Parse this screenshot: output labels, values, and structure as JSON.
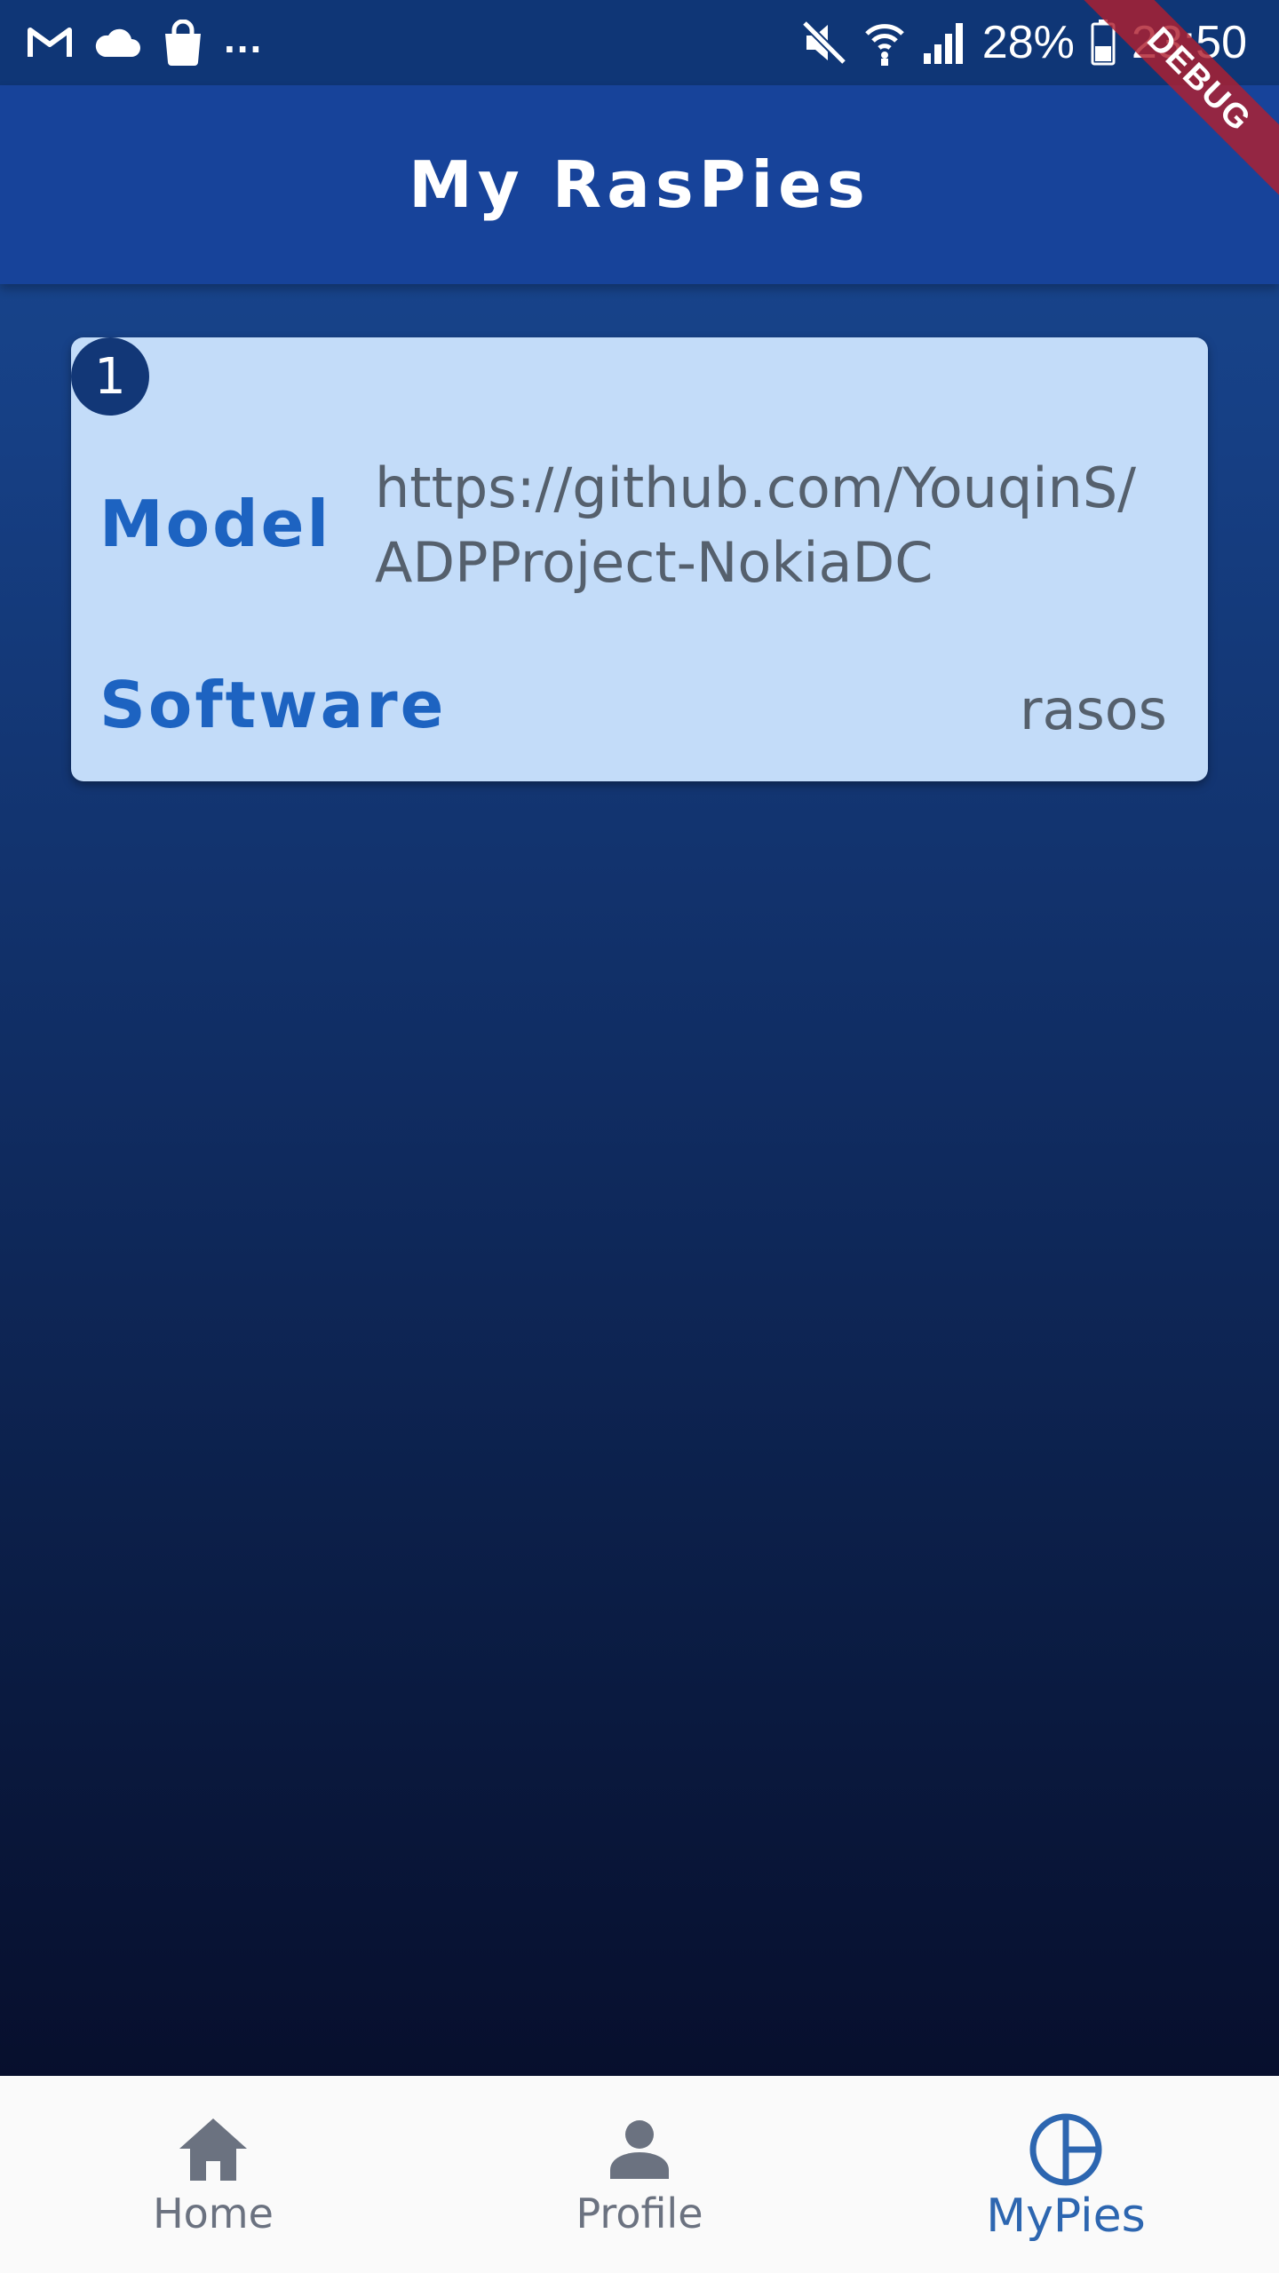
{
  "status_bar": {
    "left_icons": [
      "gmail-icon",
      "cloud-icon",
      "shopping-bag-icon"
    ],
    "more": "...",
    "battery": "28%",
    "time": "23:50"
  },
  "debug_banner": "DEBUG",
  "app_bar": {
    "title": "My RasPies"
  },
  "cards": [
    {
      "index": "1",
      "model_label": "Model",
      "model_value": "https://github.com/YouqinS/ADPProject-NokiaDC",
      "software_label": "Software",
      "software_value": "rasos"
    }
  ],
  "bottom_nav": {
    "items": [
      {
        "label": "Home",
        "icon": "home-icon",
        "active": false
      },
      {
        "label": "Profile",
        "icon": "person-icon",
        "active": false
      },
      {
        "label": "MyPies",
        "icon": "pie-chart-icon",
        "active": true
      }
    ]
  },
  "colors": {
    "app_bar": "#17439a",
    "card_background": "#c3dcf9",
    "card_label": "#1d63c1",
    "active_nav": "#2d66b0",
    "inactive_nav": "#6b7280"
  }
}
